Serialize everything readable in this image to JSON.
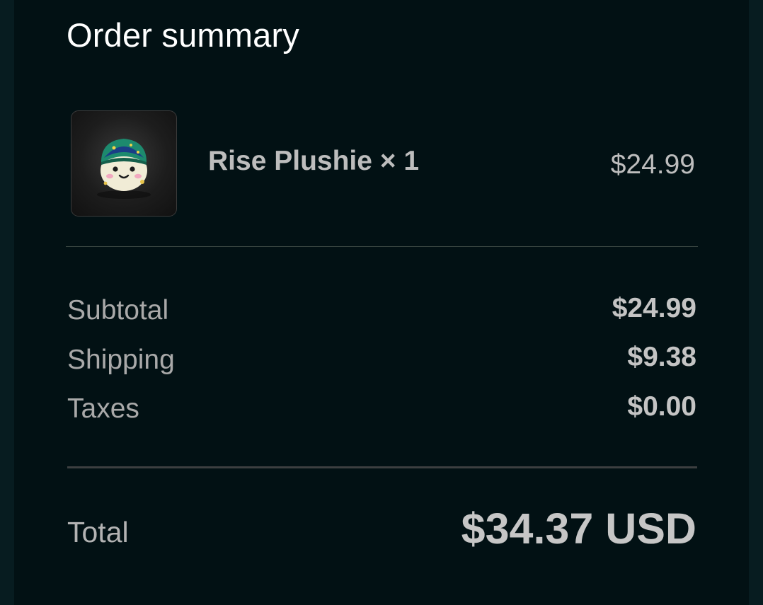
{
  "summary": {
    "title": "Order summary"
  },
  "item": {
    "name": "Rise Plushie × 1",
    "price": "$24.99",
    "image_icon": "plushie-thumbnail"
  },
  "totals": {
    "subtotal_label": "Subtotal",
    "subtotal_value": "$24.99",
    "shipping_label": "Shipping",
    "shipping_value": "$9.38",
    "taxes_label": "Taxes",
    "taxes_value": "$0.00",
    "total_label": "Total",
    "total_value": "$34.37 USD"
  },
  "colors": {
    "background": "#021114",
    "title_text": "#ffffff",
    "body_text": "#b9b9b9"
  }
}
